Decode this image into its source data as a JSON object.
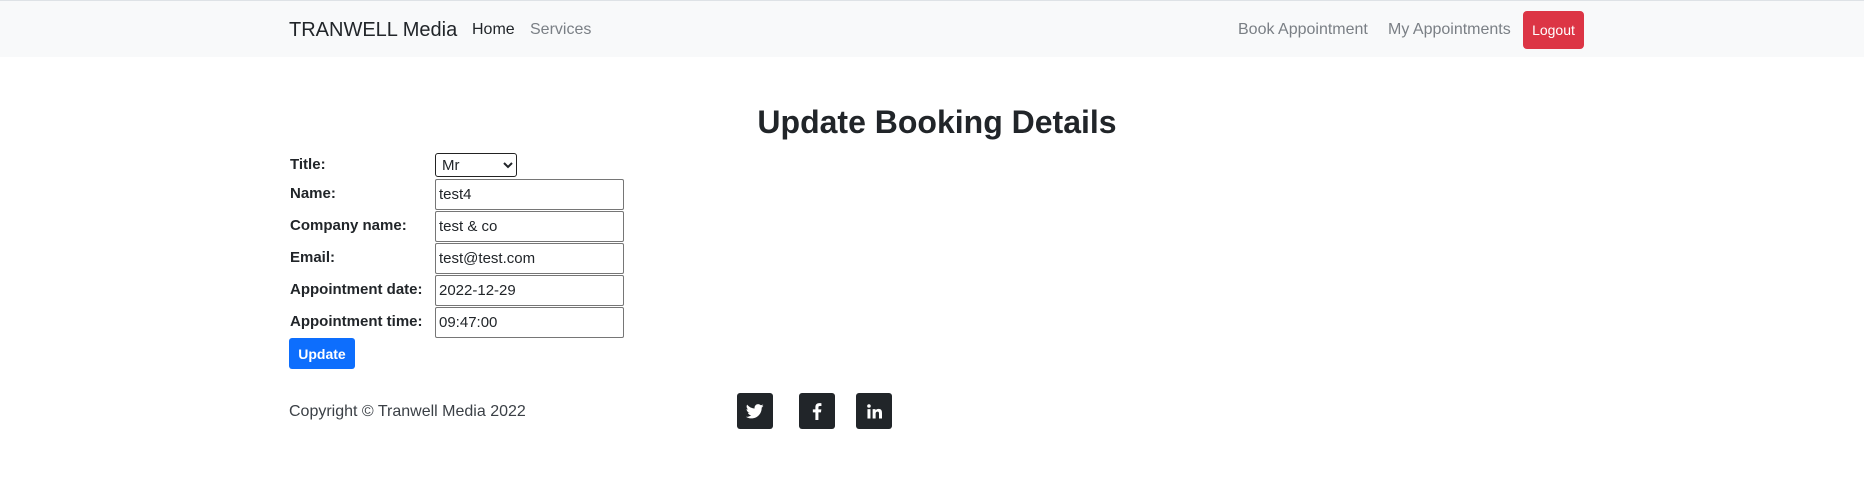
{
  "navbar": {
    "brand": "TRANWELL Media",
    "links": [
      "Home",
      "Services"
    ],
    "right_links": [
      "Book Appointment",
      "My Appointments"
    ],
    "logout_label": "Logout"
  },
  "page": {
    "title": "Update Booking Details"
  },
  "form": {
    "title_label": "Title:",
    "title_selected": "Mr",
    "name_label": "Name:",
    "name_value": "test4",
    "company_label": "Company name:",
    "company_value": "test & co",
    "email_label": "Email:",
    "email_value": "test@test.com",
    "date_label": "Appointment date:",
    "date_value": "2022-12-29",
    "time_label": "Appointment time:",
    "time_value": "09:47:00",
    "submit_label": "Update"
  },
  "footer": {
    "copyright": "Copyright © Tranwell Media 2022",
    "social_icons": [
      "twitter-icon",
      "facebook-icon",
      "linkedin-icon"
    ]
  },
  "colors": {
    "navbar_bg": "#f8f9fa",
    "logout": "#dc3545",
    "primary": "#0d6efd",
    "social_bg": "#212529"
  }
}
